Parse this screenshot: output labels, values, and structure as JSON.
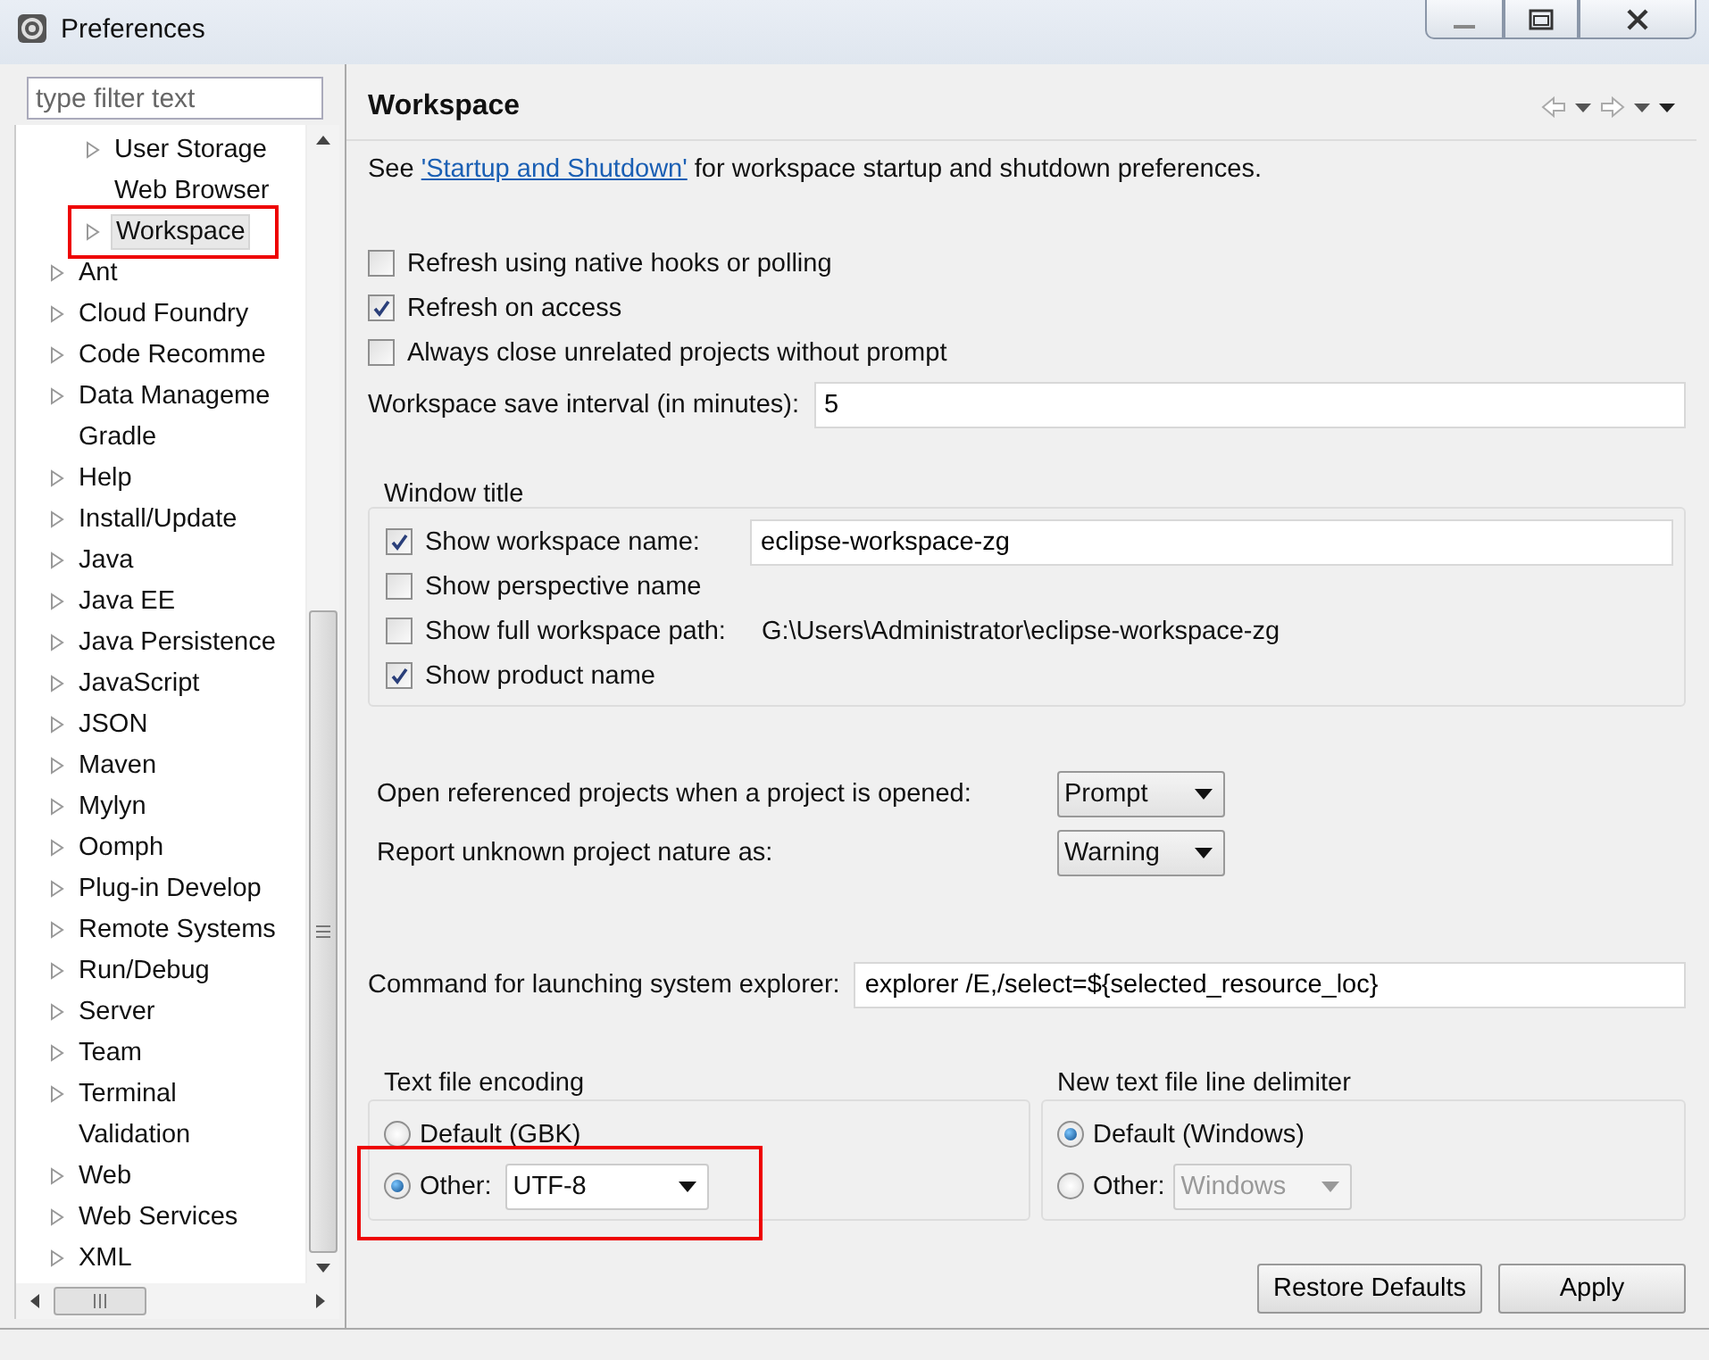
{
  "window": {
    "title": "Preferences"
  },
  "filter": {
    "placeholder": "type filter text"
  },
  "tree": {
    "nested_items": [
      {
        "label": "User Storage",
        "expandable": true,
        "selected": false,
        "annotated": false
      },
      {
        "label": "Web Browser",
        "expandable": false,
        "selected": false,
        "annotated": false
      },
      {
        "label": "Workspace",
        "expandable": true,
        "selected": true,
        "annotated": true
      }
    ],
    "items": [
      {
        "label": "Ant",
        "expandable": true
      },
      {
        "label": "Cloud Foundry",
        "expandable": true
      },
      {
        "label": "Code Recomme",
        "expandable": true
      },
      {
        "label": "Data Manageme",
        "expandable": true
      },
      {
        "label": "Gradle",
        "expandable": false
      },
      {
        "label": "Help",
        "expandable": true
      },
      {
        "label": "Install/Update",
        "expandable": true
      },
      {
        "label": "Java",
        "expandable": true
      },
      {
        "label": "Java EE",
        "expandable": true
      },
      {
        "label": "Java Persistence",
        "expandable": true
      },
      {
        "label": "JavaScript",
        "expandable": true
      },
      {
        "label": "JSON",
        "expandable": true
      },
      {
        "label": "Maven",
        "expandable": true
      },
      {
        "label": "Mylyn",
        "expandable": true
      },
      {
        "label": "Oomph",
        "expandable": true
      },
      {
        "label": "Plug-in Develop",
        "expandable": true
      },
      {
        "label": "Remote Systems",
        "expandable": true
      },
      {
        "label": "Run/Debug",
        "expandable": true
      },
      {
        "label": "Server",
        "expandable": true
      },
      {
        "label": "Team",
        "expandable": true
      },
      {
        "label": "Terminal",
        "expandable": true
      },
      {
        "label": "Validation",
        "expandable": false
      },
      {
        "label": "Web",
        "expandable": true
      },
      {
        "label": "Web Services",
        "expandable": true
      },
      {
        "label": "XML",
        "expandable": true
      }
    ]
  },
  "page": {
    "title": "Workspace",
    "intro_before": "See ",
    "intro_link": "'Startup and Shutdown'",
    "intro_after": " for workspace startup and shutdown preferences."
  },
  "options": [
    {
      "label": "Refresh using native hooks or polling",
      "checked": false
    },
    {
      "label": "Refresh on access",
      "checked": true
    },
    {
      "label": "Always close unrelated projects without prompt",
      "checked": false
    }
  ],
  "save_interval": {
    "label": "Workspace save interval (in minutes):",
    "value": "5"
  },
  "window_title_group": {
    "title": "Window title",
    "rows": [
      {
        "kind": "field",
        "label": "Show workspace name:",
        "checked": true,
        "value": "eclipse-workspace-zg"
      },
      {
        "kind": "plain",
        "label": "Show perspective name",
        "checked": false
      },
      {
        "kind": "path",
        "label": "Show full workspace path:",
        "checked": false,
        "path": "G:\\Users\\Administrator\\eclipse-workspace-zg"
      },
      {
        "kind": "plain",
        "label": "Show product name",
        "checked": true
      }
    ]
  },
  "selects": [
    {
      "label": "Open referenced projects when a project is opened:",
      "value": "Prompt"
    },
    {
      "label": "Report unknown project nature as:",
      "value": "Warning"
    }
  ],
  "explorer_command": {
    "label": "Command for launching system explorer:",
    "value": "explorer /E,/select=${selected_resource_loc}"
  },
  "encoding": {
    "title": "Text file encoding",
    "options": [
      {
        "kind": "plain",
        "label": "Default (GBK)",
        "selected": false,
        "annotated": false
      },
      {
        "kind": "select",
        "label": "Other:",
        "selected": true,
        "value": "UTF-8",
        "disabled": false,
        "annotated": true
      }
    ]
  },
  "delimiter": {
    "title": "New text file line delimiter",
    "options": [
      {
        "kind": "plain",
        "label": "Default (Windows)",
        "selected": true,
        "annotated": false
      },
      {
        "kind": "select",
        "label": "Other:",
        "selected": false,
        "value": "Windows",
        "disabled": true,
        "annotated": false
      }
    ]
  },
  "buttons": [
    "Restore Defaults",
    "Apply"
  ]
}
